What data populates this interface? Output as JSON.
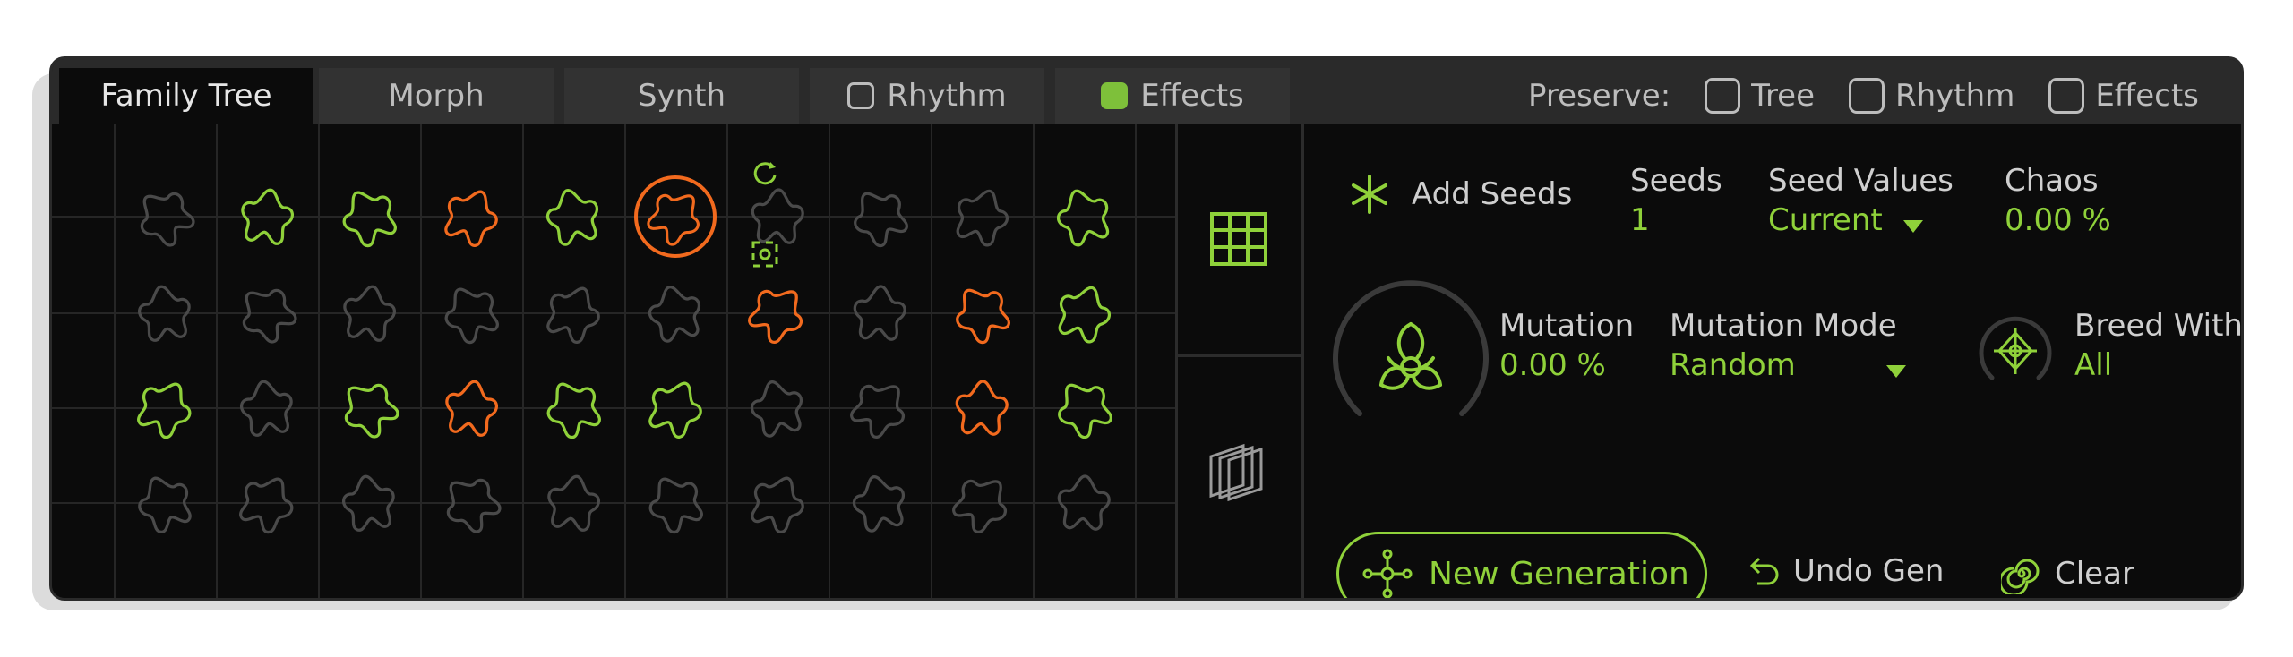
{
  "tabs": [
    {
      "label": "Family Tree",
      "active": true
    },
    {
      "label": "Morph"
    },
    {
      "label": "Synth"
    },
    {
      "label": "Rhythm",
      "checked": false
    },
    {
      "label": "Effects",
      "checked": true
    }
  ],
  "preserve": {
    "label": "Preserve:",
    "options": [
      {
        "label": "Tree",
        "checked": false
      },
      {
        "label": "Rhythm",
        "checked": false
      },
      {
        "label": "Effects",
        "checked": false
      }
    ]
  },
  "controls": {
    "add_seeds": "Add Seeds",
    "seeds": {
      "label": "Seeds",
      "value": "1"
    },
    "seed_values": {
      "label": "Seed Values",
      "value": "Current"
    },
    "chaos": {
      "label": "Chaos",
      "value": "0.00 %"
    },
    "mutation": {
      "label": "Mutation",
      "value": "0.00 %"
    },
    "mutation_mode": {
      "label": "Mutation Mode",
      "value": "Random"
    },
    "breed_with": {
      "label": "Breed With",
      "value": "All"
    },
    "new_generation": "New Generation",
    "undo_gen": "Undo Gen",
    "clear": "Clear"
  },
  "colors": {
    "accent": "#8fd13a",
    "orange": "#f26a1e",
    "gray": "#4a4a4a"
  },
  "family_tree": {
    "rows": [
      [
        "gray",
        "green",
        "green",
        "orange",
        "green",
        "selected",
        "gray",
        "gray",
        "gray",
        "green"
      ],
      [
        "gray",
        "gray",
        "gray",
        "gray",
        "gray",
        "gray",
        "orange",
        "gray",
        "orange",
        "green"
      ],
      [
        "green",
        "gray",
        "green",
        "orange",
        "green",
        "green",
        "gray",
        "gray",
        "orange",
        "green"
      ],
      [
        "gray",
        "gray",
        "gray",
        "gray",
        "gray",
        "gray",
        "gray",
        "gray",
        "gray",
        "gray"
      ]
    ]
  }
}
